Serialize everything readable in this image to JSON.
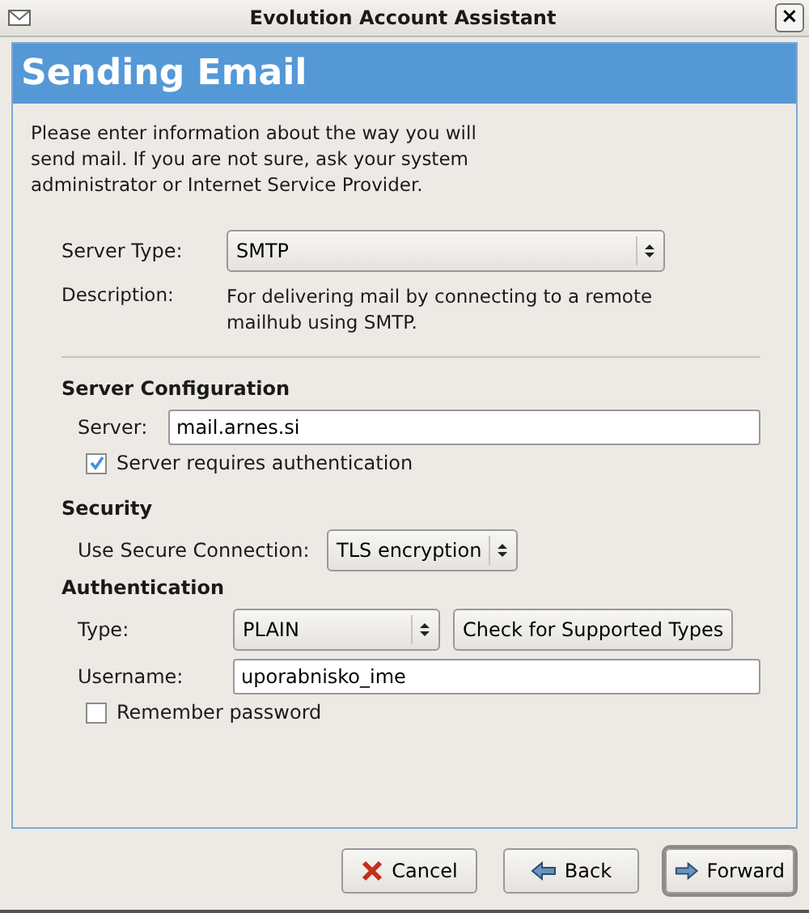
{
  "window": {
    "title": "Evolution Account Assistant",
    "close": "×"
  },
  "header": {
    "title": "Sending Email"
  },
  "intro": "Please enter information about the way you will send mail. If you are not sure, ask your system administrator or Internet Service Provider.",
  "server_type": {
    "label": "Server Type:",
    "value": "SMTP"
  },
  "description": {
    "label": "Description:",
    "text": "For delivering mail by connecting to a remote mailhub using SMTP."
  },
  "server_configuration": {
    "heading": "Server Configuration",
    "server_label": "Server:",
    "server_value": "mail.arnes.si",
    "auth_checkbox": {
      "label": "Server requires authentication",
      "checked": true
    }
  },
  "security": {
    "heading": "Security",
    "label": "Use Secure Connection:",
    "value": "TLS encryption"
  },
  "authentication": {
    "heading": "Authentication",
    "type_label": "Type:",
    "type_value": "PLAIN",
    "check_button": "Check for Supported Types",
    "username_label": "Username:",
    "username_value": "uporabnisko_ime",
    "remember": {
      "label": "Remember password",
      "checked": false
    }
  },
  "buttons": [
    {
      "kind": "cancel",
      "label": "Cancel",
      "default": false
    },
    {
      "kind": "back",
      "label": "Back",
      "default": false
    },
    {
      "kind": "forward",
      "label": "Forward",
      "default": true
    }
  ]
}
